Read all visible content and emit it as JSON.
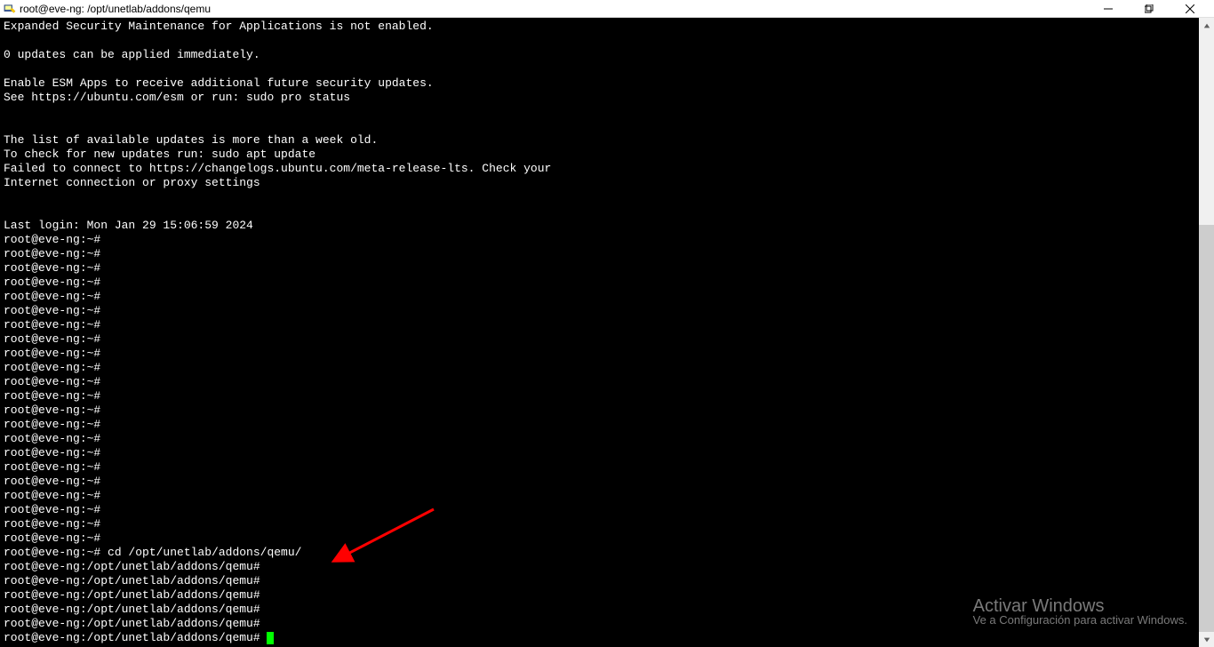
{
  "window": {
    "title": "root@eve-ng: /opt/unetlab/addons/qemu"
  },
  "terminal": {
    "lines": [
      "Expanded Security Maintenance for Applications is not enabled.",
      "",
      "0 updates can be applied immediately.",
      "",
      "Enable ESM Apps to receive additional future security updates.",
      "See https://ubuntu.com/esm or run: sudo pro status",
      "",
      "",
      "The list of available updates is more than a week old.",
      "To check for new updates run: sudo apt update",
      "Failed to connect to https://changelogs.ubuntu.com/meta-release-lts. Check your",
      "Internet connection or proxy settings",
      "",
      "",
      "Last login: Mon Jan 29 15:06:59 2024",
      "root@eve-ng:~#",
      "root@eve-ng:~#",
      "root@eve-ng:~#",
      "root@eve-ng:~#",
      "root@eve-ng:~#",
      "root@eve-ng:~#",
      "root@eve-ng:~#",
      "root@eve-ng:~#",
      "root@eve-ng:~#",
      "root@eve-ng:~#",
      "root@eve-ng:~#",
      "root@eve-ng:~#",
      "root@eve-ng:~#",
      "root@eve-ng:~#",
      "root@eve-ng:~#",
      "root@eve-ng:~#",
      "root@eve-ng:~#",
      "root@eve-ng:~#",
      "root@eve-ng:~#",
      "root@eve-ng:~#",
      "root@eve-ng:~#",
      "root@eve-ng:~#",
      "root@eve-ng:~# cd /opt/unetlab/addons/qemu/",
      "root@eve-ng:/opt/unetlab/addons/qemu#",
      "root@eve-ng:/opt/unetlab/addons/qemu#",
      "root@eve-ng:/opt/unetlab/addons/qemu#",
      "root@eve-ng:/opt/unetlab/addons/qemu#",
      "root@eve-ng:/opt/unetlab/addons/qemu#",
      "root@eve-ng:/opt/unetlab/addons/qemu# "
    ]
  },
  "watermark": {
    "title": "Activar Windows",
    "subtitle": "Ve a Configuración para activar Windows."
  }
}
